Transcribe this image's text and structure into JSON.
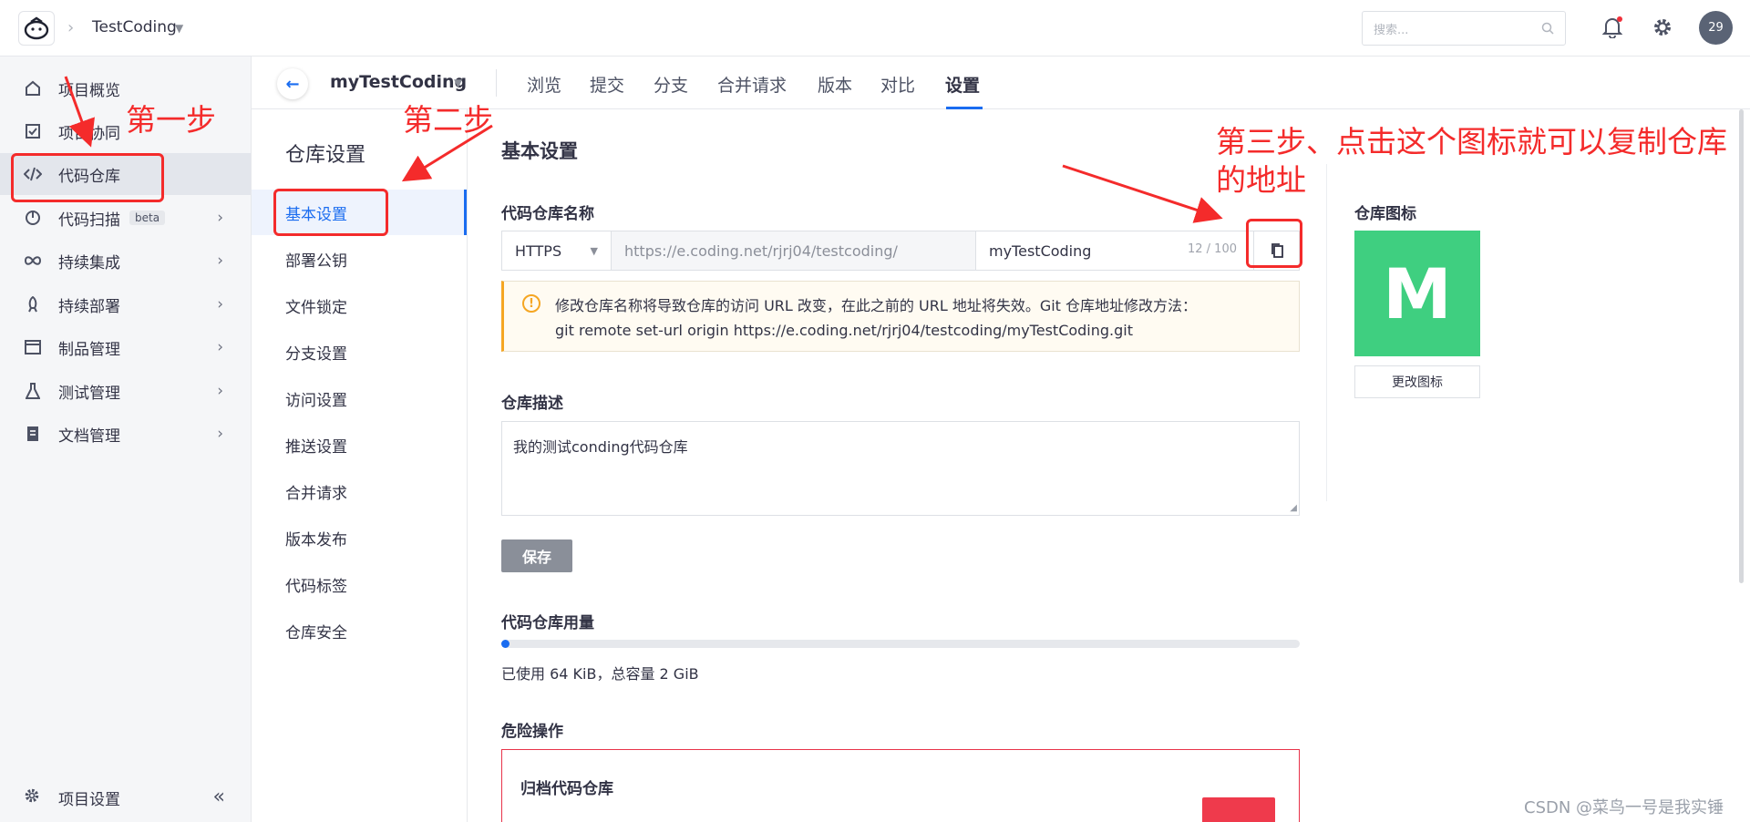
{
  "topbar": {
    "project": "TestCoding",
    "search_placeholder": "搜索...",
    "avatar_text": "29"
  },
  "sidebar": {
    "items": [
      {
        "label": "项目概览",
        "icon": "home-icon"
      },
      {
        "label": "项目协同",
        "icon": "checkbox-icon"
      },
      {
        "label": "代码仓库",
        "icon": "code-icon",
        "active": true
      },
      {
        "label": "代码扫描",
        "icon": "scan-icon",
        "badge": "beta"
      },
      {
        "label": "持续集成",
        "icon": "infinity-icon"
      },
      {
        "label": "持续部署",
        "icon": "rocket-icon"
      },
      {
        "label": "制品管理",
        "icon": "package-icon"
      },
      {
        "label": "测试管理",
        "icon": "flask-icon"
      },
      {
        "label": "文档管理",
        "icon": "document-icon"
      }
    ],
    "bottom_label": "项目设置"
  },
  "repo_header": {
    "name": "myTestCoding",
    "tabs": [
      "浏览",
      "提交",
      "分支",
      "合并请求",
      "版本",
      "对比",
      "设置"
    ],
    "active_tab": "设置"
  },
  "subnav": {
    "title": "仓库设置",
    "items": [
      "基本设置",
      "部署公钥",
      "文件锁定",
      "分支设置",
      "访问设置",
      "推送设置",
      "合并请求",
      "版本发布",
      "代码标签",
      "仓库安全"
    ],
    "active": "基本设置"
  },
  "main": {
    "title": "基本设置",
    "name_label": "代码仓库名称",
    "protocol": "HTTPS",
    "base_url": "https://e.coding.net/rjrj04/testcoding/",
    "repo_name_value": "myTestCoding",
    "counter": "12 / 100",
    "warning_line1": "修改仓库名称将导致仓库的访问 URL 改变，在此之前的 URL 地址将失效。Git 仓库地址修改方法：",
    "warning_line2": "git remote set-url origin https://e.coding.net/rjrj04/testcoding/myTestCoding.git",
    "desc_label": "仓库描述",
    "desc_value": "我的测试conding代码仓库",
    "save_label": "保存",
    "usage_label": "代码仓库用量",
    "usage_fraction": 0.01,
    "usage_text": "已使用 64 KiB，总容量 2 GiB",
    "danger_label": "危险操作",
    "archive_title": "归档代码仓库"
  },
  "icon_panel": {
    "label": "仓库图标",
    "letter": "M",
    "color": "#3fcf80",
    "change_label": "更改图标"
  },
  "annotations": {
    "step1": "第一步",
    "step2": "第二步",
    "step3_line1": "第三步、点击这个图标就可以复制仓库",
    "step3_line2": "的地址",
    "color": "#f42b2b"
  },
  "watermark": "CSDN @菜鸟一号是我实锤"
}
